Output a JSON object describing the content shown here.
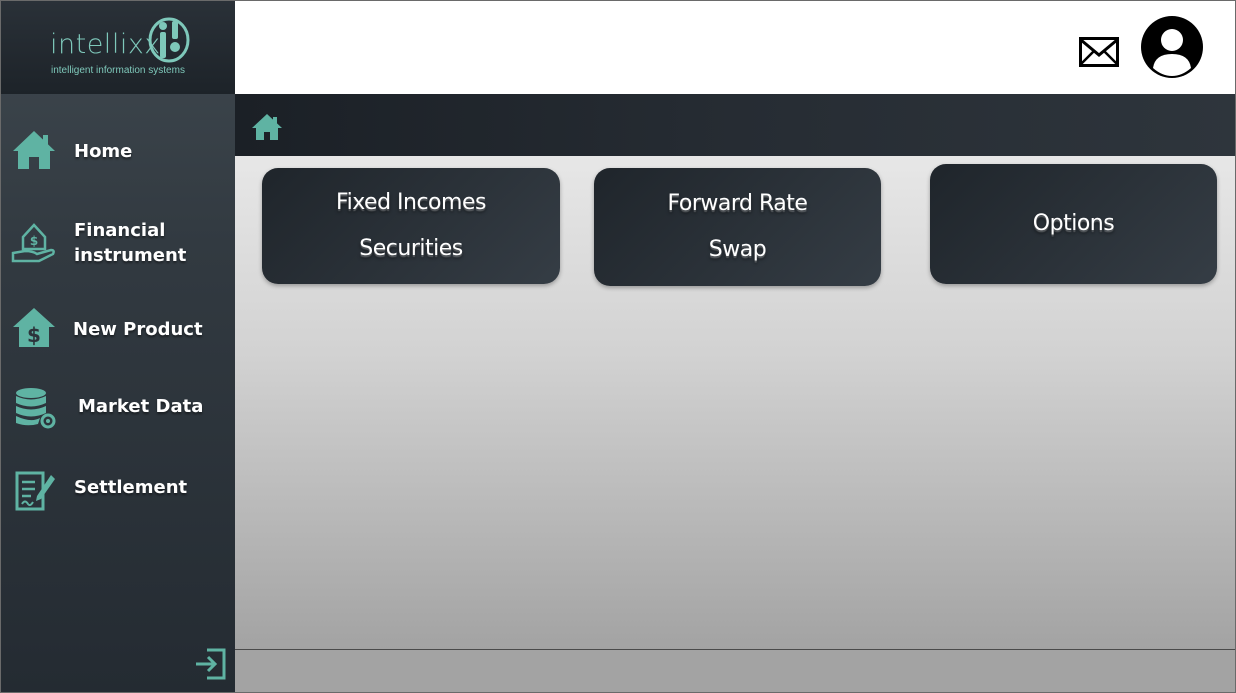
{
  "brand": {
    "name": "intellixx",
    "tagline": "intelligent information systems",
    "accent_color": "#5fb3a3",
    "icon": "intellixx-logo-mark"
  },
  "sidebar": {
    "items": [
      {
        "label": "Home",
        "icon": "home-icon"
      },
      {
        "label_line1": "Financial",
        "label_line2": "instrument",
        "icon": "hand-money-house-icon"
      },
      {
        "label": "New Product",
        "icon": "house-dollar-icon"
      },
      {
        "label": "Market Data",
        "icon": "database-gear-icon"
      },
      {
        "label": "Settlement",
        "icon": "document-pen-icon"
      }
    ],
    "logout_icon": "logout-icon"
  },
  "header": {
    "mail_icon": "mail-icon",
    "avatar_icon": "user-avatar-icon"
  },
  "breadcrumb": {
    "icon": "home-icon"
  },
  "tiles": [
    {
      "line1": "Fixed Incomes",
      "line2": "Securities"
    },
    {
      "line1": "Forward Rate",
      "line2": "Swap"
    },
    {
      "line1": "Options"
    }
  ]
}
